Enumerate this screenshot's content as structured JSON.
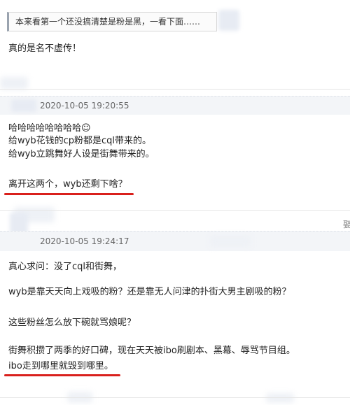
{
  "post1": {
    "quote": "本来看第一个还没搞清楚是粉是黑，一看下面……",
    "body": "真的是名不虚传！"
  },
  "post2": {
    "timestamp": "2020-10-05 19:20:55",
    "lines": [
      "哈哈哈哈哈哈哈哈☺",
      "给wyb花钱的cp粉都是cql带来的。",
      "给wyb立跳舞好人设是街舞带来的。",
      "离开这两个，wyb还剩下啥？"
    ]
  },
  "post3": {
    "timestamp": "2020-10-05 19:24:17",
    "side_label": "娶",
    "lines": [
      "真心求问：没了cql和街舞，",
      "wyb是靠天天向上戏吸的粉？还是靠无人问津的扑街大男主剧吸的粉？",
      "这些粉丝怎么放下碗就骂娘呢？",
      "街舞积攒了两季的好口碑，现在天天被ibo刷剧本、黑幕、辱骂节目组。",
      "ibo走到哪里就毁到哪里。"
    ]
  },
  "colors": {
    "underline": "#d9201c",
    "meta_text": "#666666",
    "quote_border": "#9aa3af"
  }
}
